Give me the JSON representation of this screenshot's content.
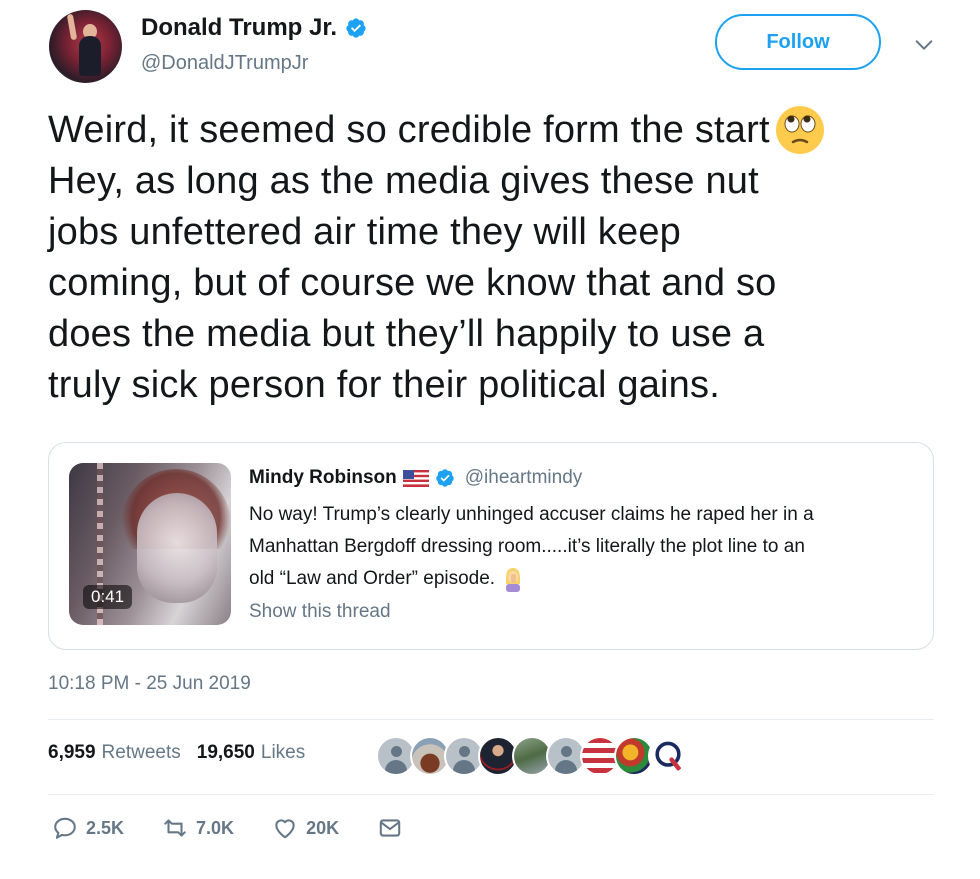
{
  "author": {
    "name": "Donald Trump Jr.",
    "handle": "@DonaldJTrumpJr",
    "verified": true,
    "avatar_icon": "avatar"
  },
  "header": {
    "follow_label": "Follow",
    "menu_icon": "chevron-down-icon"
  },
  "tweet": {
    "lines": [
      "Weird, it seemed so credible form the start",
      "Hey, as long as the media gives these nut",
      "jobs unfettered air time they will keep",
      "coming, but of course we know that and so",
      "does the media but they’ll happily to use a",
      "truly sick person for their political gains."
    ],
    "emoji": "face-with-rolling-eyes"
  },
  "quote": {
    "name": "Mindy Robinson",
    "handle": "@iheartmindy",
    "flag_icon": "us-flag-icon",
    "verified": true,
    "lines": [
      "No way! Trump’s clearly unhinged accuser claims he raped her in a",
      "Manhattan Bergdoff dressing room.....it’s literally the plot line to an",
      "old “Law and Order” episode."
    ],
    "emoji": "woman-facepalming",
    "thread_link": "Show this thread",
    "video_duration": "0:41"
  },
  "timestamp": "10:18 PM - 25 Jun 2019",
  "stats": {
    "retweets_count": "6,959",
    "retweets_label": "Retweets",
    "likes_count": "19,650",
    "likes_label": "Likes"
  },
  "likers": [
    "default-avatar",
    "arch-photo-avatar",
    "default-avatar",
    "man-in-suit-avatar",
    "landscape-avatar",
    "default-avatar",
    "flag-avatar",
    "colorful-avatar",
    "q-logo-avatar"
  ],
  "actions": {
    "reply_count": "2.5K",
    "retweet_count": "7.0K",
    "like_count": "20K"
  },
  "colors": {
    "accent": "#1da1f2",
    "text": "#14171a",
    "muted": "#657786",
    "border": "#e6ecf0"
  }
}
